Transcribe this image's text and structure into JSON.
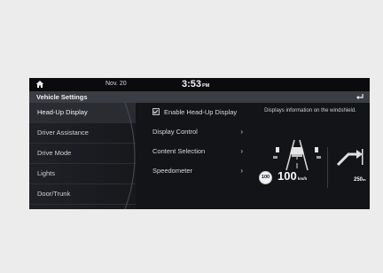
{
  "status_bar": {
    "home_icon": "home-icon",
    "date": "Nov. 20",
    "time": "3:53",
    "ampm": "PM"
  },
  "header": {
    "title": "Vehicle Settings",
    "back_icon": "back-arrow-icon"
  },
  "menu": {
    "items": [
      {
        "label": "Head-Up Display",
        "active": true
      },
      {
        "label": "Driver Assistance"
      },
      {
        "label": "Drive Mode"
      },
      {
        "label": "Lights"
      },
      {
        "label": "Door/Trunk"
      }
    ]
  },
  "options": {
    "enable_hud": {
      "label": "Enable Head-Up Display",
      "checked": true
    },
    "items": [
      {
        "label": "Display Control",
        "chevron": "›"
      },
      {
        "label": "Content Selection",
        "chevron": "›"
      },
      {
        "label": "Speedometer",
        "chevron": "›"
      }
    ]
  },
  "info": {
    "description": "Displays information on the windshield.",
    "speed_limit": "100",
    "speed": "100",
    "speed_unit": "km/h",
    "distance": "250",
    "distance_unit": "m"
  }
}
